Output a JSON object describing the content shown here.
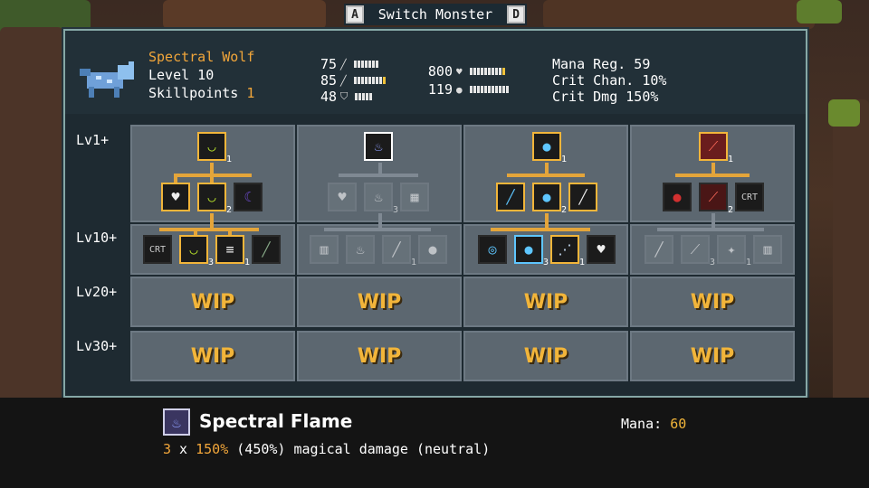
{
  "switch": {
    "left_key": "A",
    "label": "Switch Monster",
    "right_key": "D"
  },
  "monster": {
    "name": "Spectral Wolf",
    "level_label": "Level 10",
    "skillpoints_label": "Skillpoints",
    "skillpoints": "1"
  },
  "stats": {
    "attack": "75",
    "magic": "85",
    "defense": "48",
    "health": "800",
    "shield": "119"
  },
  "rstats": {
    "mana_reg": "Mana Reg.  59",
    "crit_chance": "Crit Chan.  10%",
    "crit_dmg": "Crit Dmg  150%"
  },
  "rows": [
    "Lv1+",
    "Lv10+",
    "Lv20+",
    "Lv30+"
  ],
  "wip": "WIP",
  "skill_counts": {
    "c1_top": "1",
    "c1_mid": "2",
    "c1_l10a": "3",
    "c1_l10b": "1",
    "c2_mid": "3",
    "c2_l10": "1",
    "c3_top": "1",
    "c3_mid": "2",
    "c3_l10a": "3",
    "c3_l10b": "1",
    "c4_top": "1",
    "c4_mid": "2",
    "c4_l10a": "3",
    "c4_l10b": "1"
  },
  "selected_skill": {
    "name": "Spectral Flame",
    "mana_label": "Mana:",
    "mana": "60",
    "desc_count": "3",
    "desc_x": " x ",
    "desc_pct": "150%",
    "desc_rest": " (450%) magical damage (neutral)"
  }
}
